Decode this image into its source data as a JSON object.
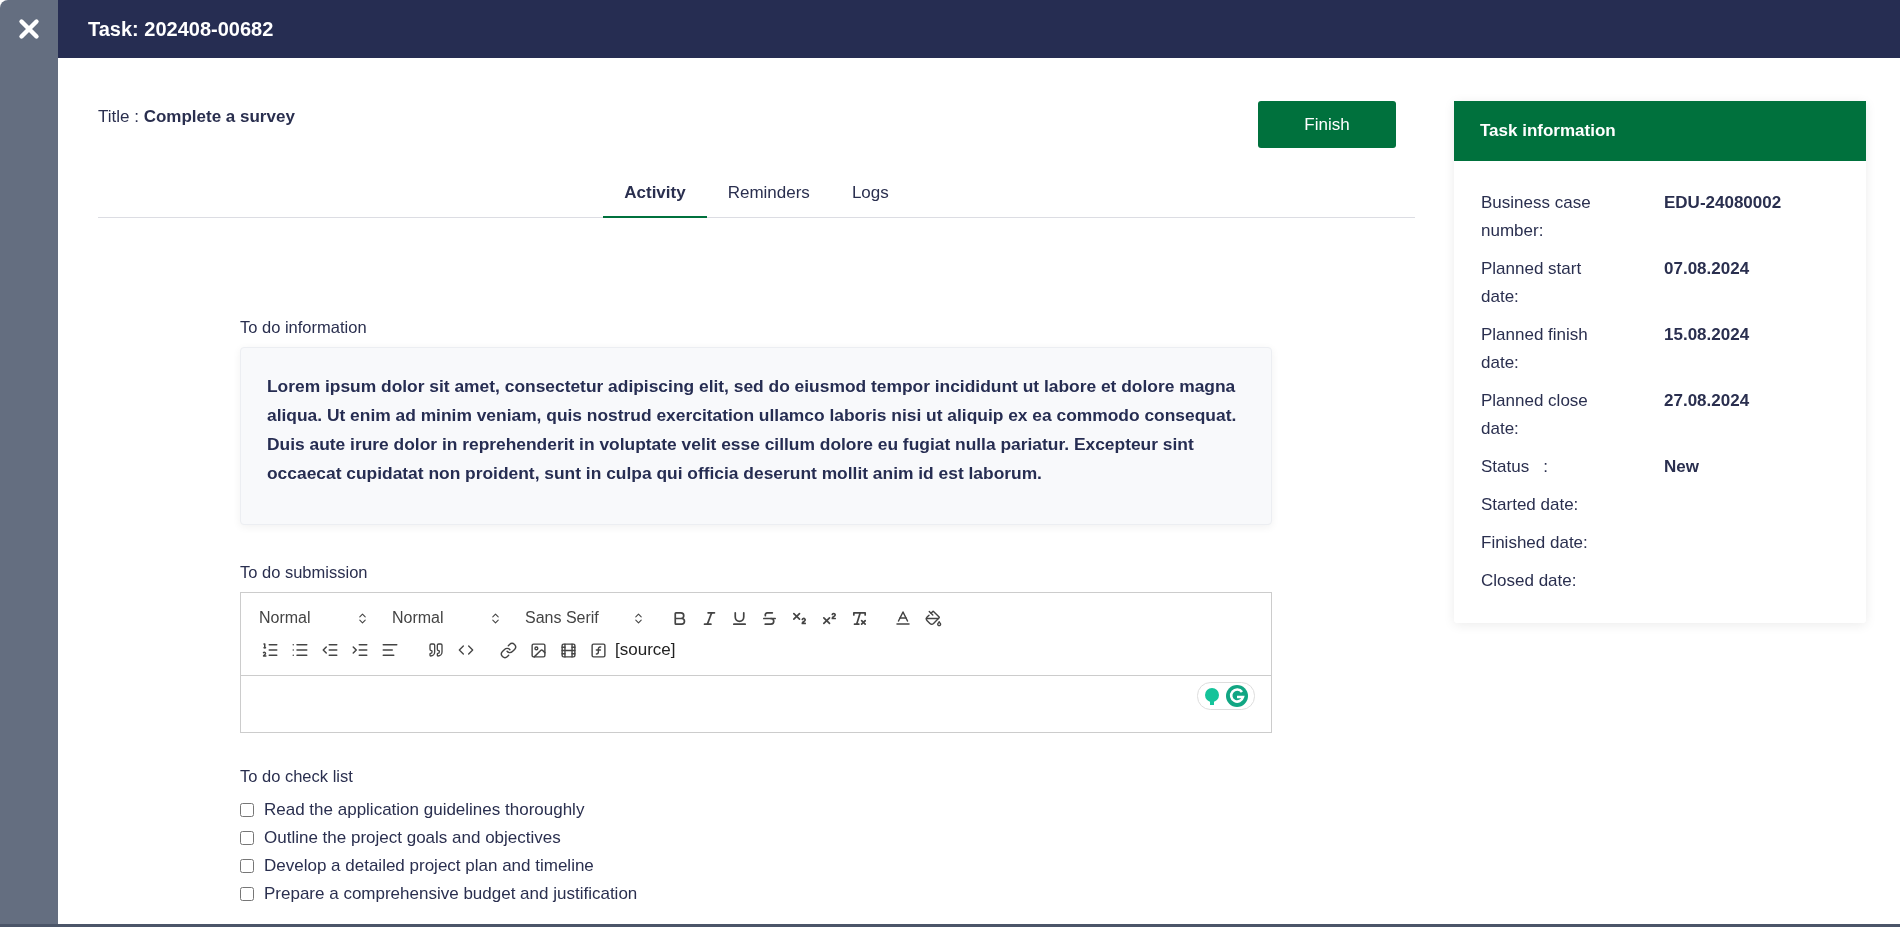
{
  "header": {
    "title": "Task: 202408-00682"
  },
  "task": {
    "title_label": "Title :",
    "title_value": "Complete a survey",
    "finish_button": "Finish"
  },
  "tabs": [
    {
      "label": "Activity",
      "selected": true
    },
    {
      "label": "Reminders",
      "selected": false
    },
    {
      "label": "Logs",
      "selected": false
    }
  ],
  "info": {
    "label": "To do information",
    "text": "Lorem ipsum dolor sit amet, consectetur adipiscing elit, sed do eiusmod tempor incididunt ut labore et dolore magna aliqua. Ut enim ad minim veniam, quis nostrud exercitation ullamco laboris nisi ut aliquip ex ea commodo consequat. Duis aute irure dolor in reprehenderit in voluptate velit esse cillum dolore eu fugiat nulla pariatur. Excepteur sint occaecat cupidatat non proident, sunt in culpa qui officia deserunt mollit anim id est laborum."
  },
  "submission": {
    "label": "To do submission",
    "selects": [
      "Normal",
      "Normal",
      "Sans Serif"
    ],
    "source_label": "[source]"
  },
  "checklist": {
    "label": "To do check list",
    "items": [
      {
        "label": "Read the application guidelines thoroughly",
        "checked": false
      },
      {
        "label": "Outline the project goals and objectives",
        "checked": false
      },
      {
        "label": "Develop a detailed project plan and timeline",
        "checked": false
      },
      {
        "label": "Prepare a comprehensive budget and justification",
        "checked": false
      }
    ]
  },
  "task_information": {
    "title": "Task information",
    "rows": [
      {
        "label": "Business case number:",
        "value": "EDU-24080002"
      },
      {
        "label": "Planned start date:",
        "value": "07.08.2024"
      },
      {
        "label": "Planned finish date:",
        "value": "15.08.2024"
      },
      {
        "label": "Planned close date:",
        "value": "27.08.2024"
      },
      {
        "label": "Status   :",
        "value": "New"
      },
      {
        "label": "Started date:"
      },
      {
        "label": "Finished date:"
      },
      {
        "label": "Closed date:"
      }
    ]
  }
}
